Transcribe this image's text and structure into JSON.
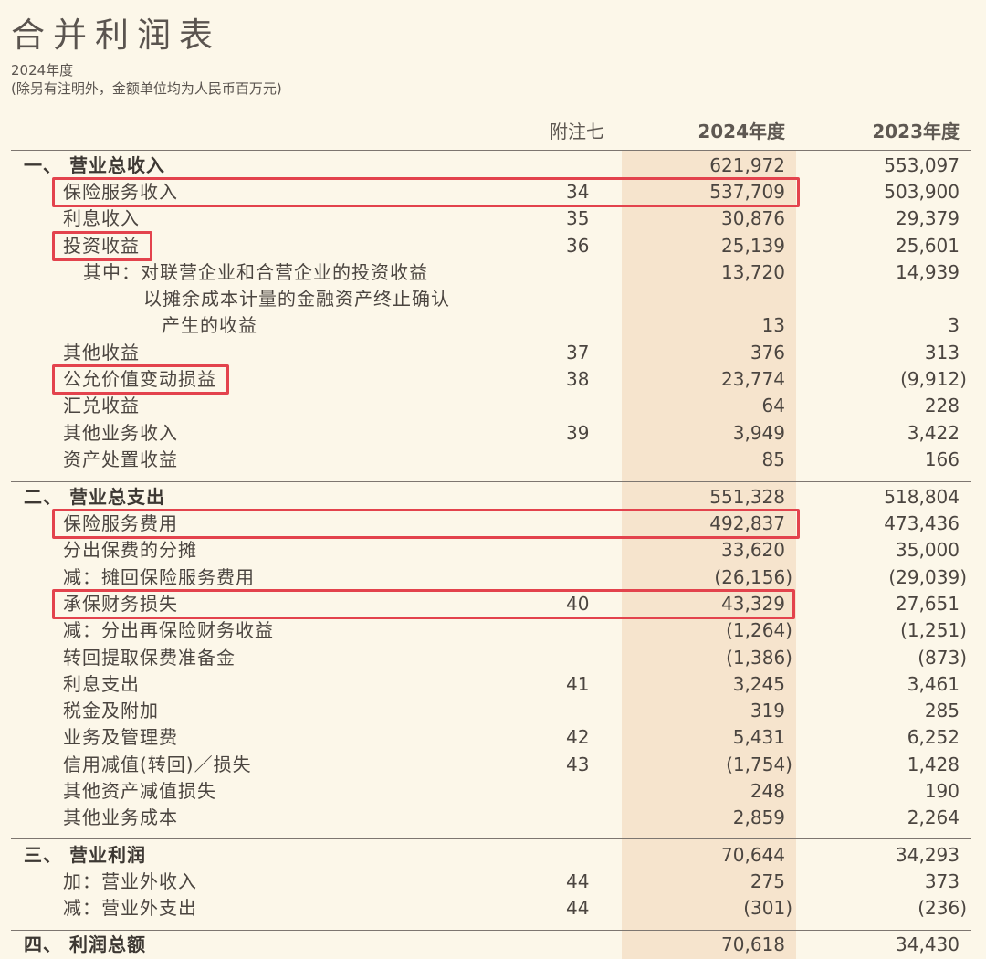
{
  "title": "合并利润表",
  "subtitle_year": "2024年度",
  "subtitle_note": "(除另有注明外，金额单位均为人民币百万元)",
  "headers": {
    "note": "附注七",
    "y2024": "2024年度",
    "y2023": "2023年度"
  },
  "rows": [
    {
      "label": "一、 营业总收入",
      "note": "",
      "v2024": "621,972",
      "v2023": "553,097"
    },
    {
      "label": "保险服务收入",
      "note": "34",
      "v2024": "537,709",
      "v2023": "503,900"
    },
    {
      "label": "利息收入",
      "note": "35",
      "v2024": "30,876",
      "v2023": "29,379"
    },
    {
      "label": "投资收益",
      "note": "36",
      "v2024": "25,139",
      "v2023": "25,601"
    },
    {
      "label": "其中：对联营企业和合营企业的投资收益",
      "note": "",
      "v2024": "13,720",
      "v2023": "14,939"
    },
    {
      "label": "以摊余成本计量的金融资产终止确认",
      "note": "",
      "v2024": "",
      "v2023": ""
    },
    {
      "label": "产生的收益",
      "note": "",
      "v2024": "13",
      "v2023": "3"
    },
    {
      "label": "其他收益",
      "note": "37",
      "v2024": "376",
      "v2023": "313"
    },
    {
      "label": "公允价值变动损益",
      "note": "38",
      "v2024": "23,774",
      "v2023": "(9,912)"
    },
    {
      "label": "汇兑收益",
      "note": "",
      "v2024": "64",
      "v2023": "228"
    },
    {
      "label": "其他业务收入",
      "note": "39",
      "v2024": "3,949",
      "v2023": "3,422"
    },
    {
      "label": "资产处置收益",
      "note": "",
      "v2024": "85",
      "v2023": "166"
    },
    {
      "label": "二、 营业总支出",
      "note": "",
      "v2024": "551,328",
      "v2023": "518,804"
    },
    {
      "label": "保险服务费用",
      "note": "",
      "v2024": "492,837",
      "v2023": "473,436"
    },
    {
      "label": "分出保费的分摊",
      "note": "",
      "v2024": "33,620",
      "v2023": "35,000"
    },
    {
      "label": "减：摊回保险服务费用",
      "note": "",
      "v2024": "(26,156)",
      "v2023": "(29,039)"
    },
    {
      "label": "承保财务损失",
      "note": "40",
      "v2024": "43,329",
      "v2023": "27,651"
    },
    {
      "label": "减：分出再保险财务收益",
      "note": "",
      "v2024": "(1,264)",
      "v2023": "(1,251)"
    },
    {
      "label": "转回提取保费准备金",
      "note": "",
      "v2024": "(1,386)",
      "v2023": "(873)"
    },
    {
      "label": "利息支出",
      "note": "41",
      "v2024": "3,245",
      "v2023": "3,461"
    },
    {
      "label": "税金及附加",
      "note": "",
      "v2024": "319",
      "v2023": "285"
    },
    {
      "label": "业务及管理费",
      "note": "42",
      "v2024": "5,431",
      "v2023": "6,252"
    },
    {
      "label": "信用减值(转回)／损失",
      "note": "43",
      "v2024": "(1,754)",
      "v2023": "1,428"
    },
    {
      "label": "其他资产减值损失",
      "note": "",
      "v2024": "248",
      "v2023": "190"
    },
    {
      "label": "其他业务成本",
      "note": "",
      "v2024": "2,859",
      "v2023": "2,264"
    },
    {
      "label": "三、 营业利润",
      "note": "",
      "v2024": "70,644",
      "v2023": "34,293"
    },
    {
      "label": "加：营业外收入",
      "note": "44",
      "v2024": "275",
      "v2023": "373"
    },
    {
      "label": "减：营业外支出",
      "note": "44",
      "v2024": "(301)",
      "v2023": "(236)"
    },
    {
      "label": "四、 利润总额",
      "note": "",
      "v2024": "70,618",
      "v2023": "34,430"
    }
  ]
}
